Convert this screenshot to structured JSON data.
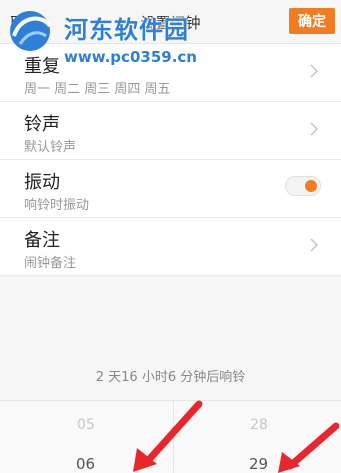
{
  "header": {
    "cancel_label": "取消",
    "title": "设置闹钟",
    "confirm_label": "确定"
  },
  "watermark": {
    "title": "河东软件园",
    "url": "www.pc0359.cn"
  },
  "settings": [
    {
      "label": "重复",
      "sub": "周一 周二 周三 周四 周五",
      "control": "chevron"
    },
    {
      "label": "铃声",
      "sub": "默认铃声",
      "control": "chevron"
    },
    {
      "label": "振动",
      "sub": "响铃时振动",
      "control": "toggle",
      "on": true
    },
    {
      "label": "备注",
      "sub": "闹钟备注",
      "control": "chevron"
    }
  ],
  "countdown": "2 天16 小时6 分钟后响铃",
  "picker": {
    "hour_prev": "05",
    "hour_current": "06",
    "minute_prev": "28",
    "minute_current": "29"
  },
  "colors": {
    "accent": "#f17c22",
    "arrow": "#e8262b",
    "watermark": "#2f7fd8"
  }
}
